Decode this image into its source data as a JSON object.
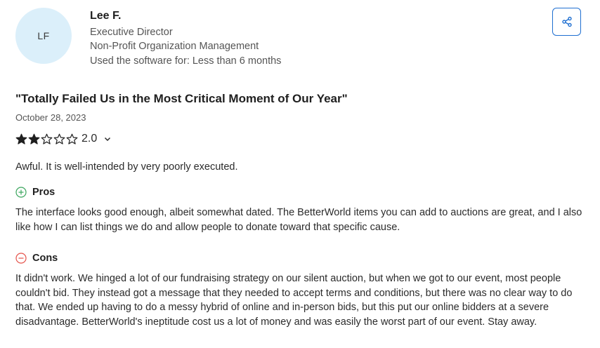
{
  "reviewer": {
    "initials": "LF",
    "name": "Lee F.",
    "title": "Executive Director",
    "industry": "Non-Profit Organization Management",
    "usage": "Used the software for: Less than 6 months"
  },
  "share": {
    "icon": "share-icon"
  },
  "review": {
    "title": "\"Totally Failed Us in the Most Critical Moment of Our Year\"",
    "date": "October 28, 2023",
    "rating": {
      "value": "2.0",
      "stars_filled": 2,
      "stars_total": 5
    },
    "summary": "Awful. It is well-intended by very poorly executed.",
    "pros_label": "Pros",
    "pros_text": "The interface looks good enough, albeit somewhat dated. The BetterWorld items you can add to auctions are great, and I also like how I can list things we do and allow people to donate toward that specific cause.",
    "cons_label": "Cons",
    "cons_text": "It didn't work. We hinged a lot of our fundraising strategy on our silent auction, but when we got to our event, most people couldn't bid. They instead got a message that they needed to accept terms and conditions, but there was no clear way to do that. We ended up having to do a messy hybrid of online and in-person bids, but this put our online bidders at a severe disadvantage. BetterWorld's ineptitude cost us a lot of money and was easily the worst part of our event. Stay away."
  },
  "colors": {
    "avatar_bg": "#dbeffa",
    "accent": "#1f6fd1",
    "pros_green": "#3aa55d",
    "cons_red": "#e5534b",
    "star": "#1f1f1f"
  }
}
